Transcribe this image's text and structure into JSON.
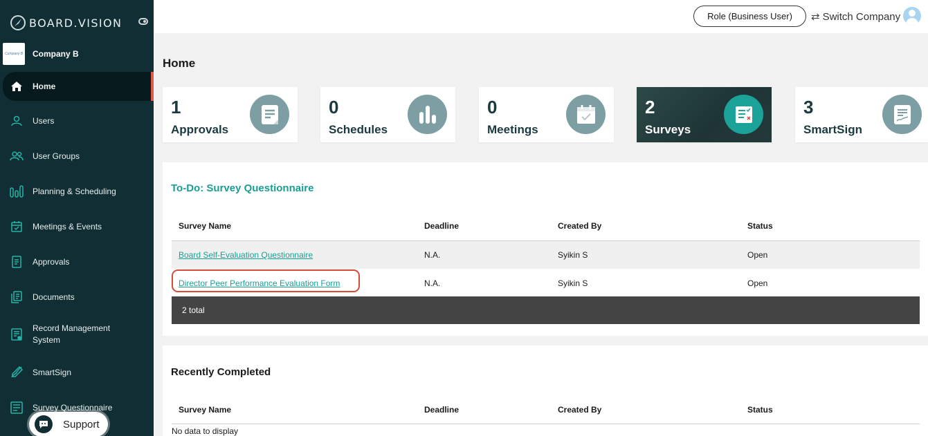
{
  "brand": {
    "name": "BOARD.VISION"
  },
  "company": {
    "name": "Company B",
    "logo_text": "Company B"
  },
  "sidebar": {
    "items": [
      {
        "label": "Home",
        "icon": "home-icon"
      },
      {
        "label": "Users",
        "icon": "user-icon"
      },
      {
        "label": "User Groups",
        "icon": "user-groups-icon"
      },
      {
        "label": "Planning & Scheduling",
        "icon": "planning-icon"
      },
      {
        "label": "Meetings & Events",
        "icon": "calendar-icon"
      },
      {
        "label": "Approvals",
        "icon": "approvals-icon"
      },
      {
        "label": "Documents",
        "icon": "documents-icon"
      },
      {
        "label": "Record Management",
        "label2": "System",
        "icon": "record-icon"
      },
      {
        "label": "SmartSign",
        "icon": "smartsign-icon"
      },
      {
        "label": "Survey Questionnaire",
        "icon": "survey-icon"
      }
    ],
    "support_label": "Support"
  },
  "topbar": {
    "role_label": "Role (Business User)",
    "switch_label": "Switch Company"
  },
  "page": {
    "title": "Home"
  },
  "cards": [
    {
      "count": "1",
      "label": "Approvals",
      "icon": "document-icon"
    },
    {
      "count": "0",
      "label": "Schedules",
      "icon": "bar-chart-icon"
    },
    {
      "count": "0",
      "label": "Meetings",
      "icon": "calendar-check-icon"
    },
    {
      "count": "2",
      "label": "Surveys",
      "icon": "survey-list-icon"
    },
    {
      "count": "3",
      "label": "SmartSign",
      "icon": "sign-document-icon"
    }
  ],
  "todo": {
    "title": "To-Do: Survey Questionnaire",
    "columns": [
      "Survey Name",
      "Deadline",
      "Created By",
      "Status"
    ],
    "rows": [
      {
        "name": "Board Self-Evaluation Questionnaire",
        "deadline": "N.A.",
        "created_by": "Syikin S",
        "status": "Open"
      },
      {
        "name": "Director Peer Performance Evaluation Form",
        "deadline": "N.A.",
        "created_by": "Syikin S",
        "status": "Open"
      }
    ],
    "total": "2 total"
  },
  "completed": {
    "title": "Recently Completed",
    "columns": [
      "Survey Name",
      "Deadline",
      "Created By",
      "Status"
    ],
    "empty_text": "No data to display"
  },
  "colors": {
    "sidebar_bg": "#102e33",
    "accent_teal": "#1a9e94",
    "highlight": "#d64a38",
    "total_bar": "#444444"
  }
}
